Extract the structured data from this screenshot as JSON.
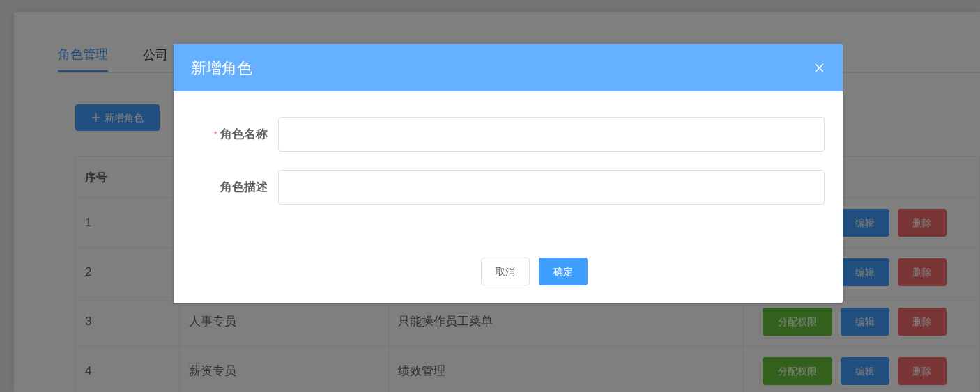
{
  "tabs": [
    {
      "label": "角色管理",
      "selected": true
    },
    {
      "label": "公司",
      "selected": false
    }
  ],
  "add_button": {
    "label": "新增角色"
  },
  "table": {
    "columns": [
      "序号"
    ],
    "rows": [
      {
        "index": "1",
        "actions": [
          {
            "kind": "edit",
            "label": "编辑"
          },
          {
            "kind": "delete",
            "label": "删除"
          }
        ]
      },
      {
        "index": "2",
        "actions": [
          {
            "kind": "edit",
            "label": "编辑"
          },
          {
            "kind": "delete",
            "label": "删除"
          }
        ]
      },
      {
        "index": "3",
        "name": "人事专员",
        "description": "只能操作员工菜单",
        "actions": [
          {
            "kind": "assign",
            "label": "分配权限"
          },
          {
            "kind": "edit",
            "label": "编辑"
          },
          {
            "kind": "delete",
            "label": "删除"
          }
        ]
      },
      {
        "index": "4",
        "name": "薪资专员",
        "description": "绩效管理",
        "actions": [
          {
            "kind": "assign",
            "label": "分配权限"
          },
          {
            "kind": "edit",
            "label": "编辑"
          },
          {
            "kind": "delete",
            "label": "删除"
          }
        ]
      }
    ]
  },
  "dialog": {
    "title": "新增角色",
    "fields": [
      {
        "label": "角色名称",
        "required_mark": "*"
      },
      {
        "label": "角色描述"
      }
    ],
    "buttons": [
      {
        "kind": "cancel",
        "label": "取消"
      },
      {
        "kind": "confirm",
        "label": "确定"
      }
    ]
  }
}
